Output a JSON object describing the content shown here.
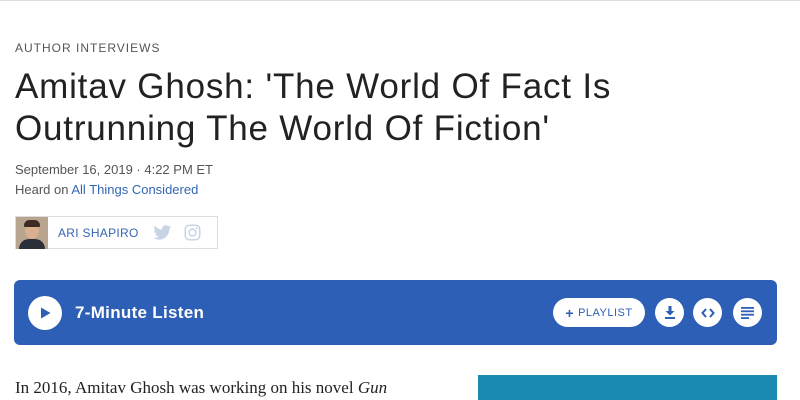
{
  "article": {
    "slug": "AUTHOR INTERVIEWS",
    "headline": "Amitav Ghosh: 'The World Of Fact Is Outrunning The World Of Fiction'",
    "date": "September 16, 2019 · 4:22 PM ET",
    "heard_prefix": "Heard on ",
    "show_name": "All Things Considered",
    "body_start": "In 2016, Amitav Ghosh was working on his novel ",
    "body_italic": "Gun"
  },
  "byline": {
    "author": "ARI SHAPIRO",
    "icons": [
      "twitter-icon",
      "instagram-icon"
    ]
  },
  "player": {
    "listen_label": "7-Minute Listen",
    "playlist_label": "PLAYLIST",
    "bg_color": "#2c5fb5",
    "icons": [
      "play-icon",
      "plus-icon",
      "download-icon",
      "embed-icon",
      "transcript-icon"
    ]
  },
  "colors": {
    "link": "#3466b3",
    "player": "#2c5fb5",
    "image_teal": "#1a8ab0"
  }
}
